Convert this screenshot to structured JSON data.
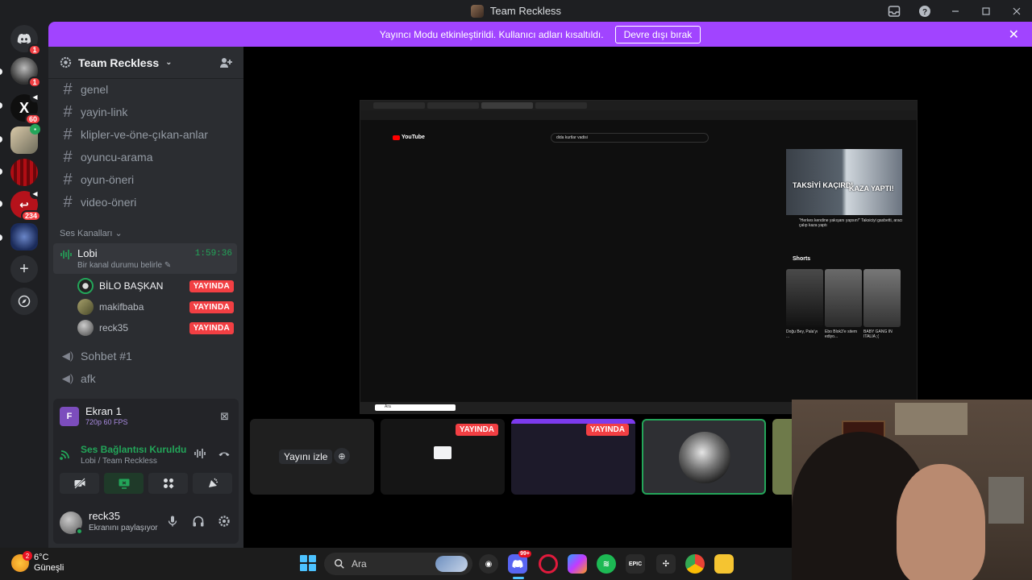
{
  "window": {
    "title": "Team Reckless"
  },
  "banner": {
    "message": "Yayıncı Modu etkinleştirildi. Kullanıcı adları kısaltıldı.",
    "button": "Devre dışı bırak"
  },
  "rail": {
    "badges": [
      "1",
      "1",
      "60",
      "234"
    ]
  },
  "guild": {
    "name": "Team Reckless"
  },
  "text_channels": [
    {
      "name": "genel"
    },
    {
      "name": "yayin-link"
    },
    {
      "name": "klipler-ve-öne-çıkan-anlar"
    },
    {
      "name": "oyuncu-arama"
    },
    {
      "name": "oyun-öneri"
    },
    {
      "name": "video-öneri"
    }
  ],
  "voice_category": "Ses Kanalları",
  "voice_channel": {
    "name": "Lobi",
    "status": "Bir kanal durumu belirle",
    "elapsed": "1:59:36",
    "users": [
      {
        "name": "BİLO BAŞKAN",
        "live": "YAYINDA"
      },
      {
        "name": "makifbaba",
        "live": "YAYINDA"
      },
      {
        "name": "reck35",
        "live": "YAYINDA"
      }
    ]
  },
  "other_voice_channels": [
    {
      "name": "Sohbet #1"
    },
    {
      "name": "afk"
    }
  ],
  "stream_panel": {
    "title": "Ekran 1",
    "quality": "720p 60 FPS"
  },
  "connection": {
    "status": "Ses Bağlantısı Kuruldu",
    "channel": "Lobi / Team Reckless"
  },
  "user": {
    "name": "reck35",
    "status": "Ekranını paylaşıyor"
  },
  "share": {
    "search_query": "dida kurtlar vadisi",
    "video_thumb_text_1": "TAKSİYİ KAÇIRDI",
    "video_thumb_text_2": "KAZA YAPTI!",
    "video_title": "\"Herkes kendine yakışanı yapsın!\" Taksiciyi gasbetti, aracı çalıp kaza yaptı",
    "shorts_label": "Shorts",
    "shorts": [
      {
        "title": "Doğu Bey, Palaʼyı ..."
      },
      {
        "title": "Ebo Blok3ʼe sitem ediyo..."
      },
      {
        "title": "BABY GANG IN ITALIA ;("
      }
    ],
    "taskbar_search": "Ara",
    "logo": "YouTube"
  },
  "tiles": {
    "watch_label": "Yayını izle",
    "live_label": "YAYINDA"
  },
  "taskbar": {
    "temp": "6°C",
    "weather": "Güneşli",
    "search_placeholder": "Ara",
    "weather_badge": "2",
    "discord_badge": "99+",
    "epic": "EPIC"
  },
  "colors": {
    "accent_purple": "#a144ff",
    "live_red": "#f23f43",
    "online_green": "#23a559"
  }
}
